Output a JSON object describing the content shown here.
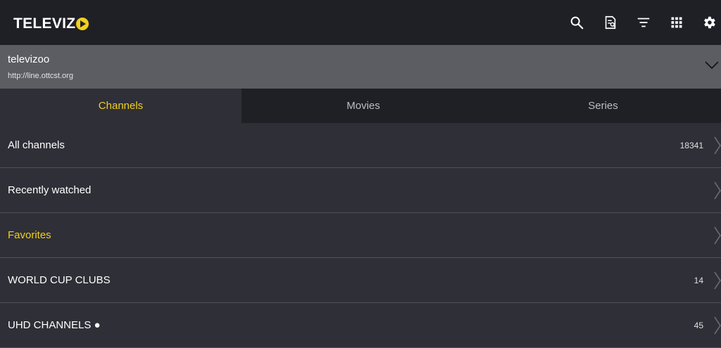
{
  "app": {
    "logo_text": "TELEVIZ",
    "accent_color": "#f2cf1c",
    "toolbar": [
      {
        "name": "search-icon",
        "icon": "search"
      },
      {
        "name": "epg-icon",
        "icon": "document-search"
      },
      {
        "name": "filter-icon",
        "icon": "sort-lines"
      },
      {
        "name": "grid-icon",
        "icon": "apps-grid"
      },
      {
        "name": "settings-icon",
        "icon": "gear"
      }
    ]
  },
  "playlist": {
    "name": "televizoo",
    "url": "http://line.ottcst.org"
  },
  "tabs": [
    {
      "label": "Channels",
      "active": true
    },
    {
      "label": "Movies",
      "active": false
    },
    {
      "label": "Series",
      "active": false
    }
  ],
  "groups": [
    {
      "label": "All channels",
      "count": "18341"
    },
    {
      "label": "Recently watched",
      "count": ""
    },
    {
      "label": "Favorites",
      "count": ""
    },
    {
      "label": "WORLD CUP CLUBS",
      "count": "14"
    },
    {
      "label": "UHD CHANNELS ●",
      "count": "45"
    }
  ]
}
